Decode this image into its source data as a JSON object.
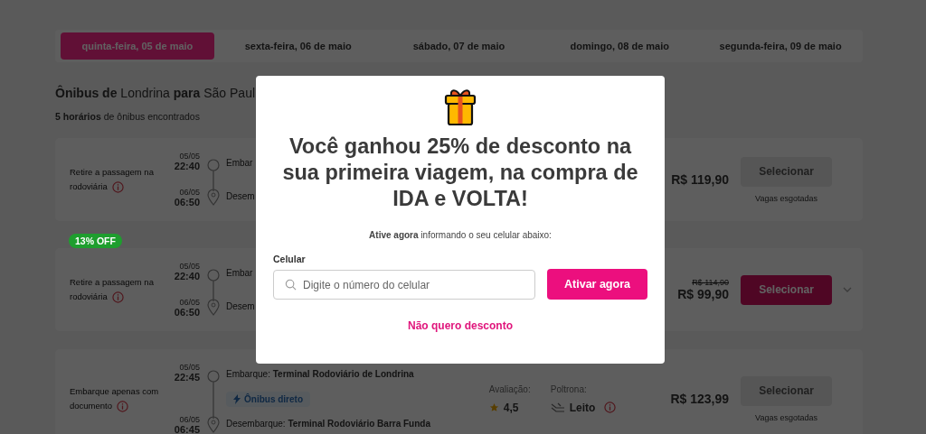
{
  "dates": [
    {
      "label": "quinta-feira, 05 de maio",
      "selected": true
    },
    {
      "label": "sexta-feira, 06 de maio",
      "selected": false
    },
    {
      "label": "sábado, 07 de maio",
      "selected": false
    },
    {
      "label": "domingo, 08 de maio",
      "selected": false
    },
    {
      "label": "segunda-feira, 09 de maio",
      "selected": false
    }
  ],
  "heading": "**Ônibus de** Londrina **para** São Paul",
  "result_count": "**5 horários** de ônibus encontrados",
  "trips": [
    {
      "note": "Retire a passagem na rodoviária",
      "depart_date": "05/05",
      "depart_time": "22:40",
      "arrive_date": "06/05",
      "arrive_time": "06:50",
      "board_label": "Embar",
      "alight_label": "Desem",
      "price": "R$ 119,90",
      "button": {
        "label": "Selecionar",
        "disabled": true
      },
      "status": "Vagas esgotadas",
      "expand_toggle": false
    },
    {
      "badge": "13% OFF",
      "note": "Retire a passagem na rodoviária",
      "depart_date": "05/05",
      "depart_time": "22:40",
      "arrive_date": "06/05",
      "arrive_time": "06:50",
      "board_label": "Embar",
      "alight_label": "Desem",
      "price_old": "R$ 114,90",
      "price": "R$ 99,90",
      "button": {
        "label": "Selecionar",
        "disabled": false
      },
      "expand_toggle": true
    },
    {
      "note": "Embarque apenas com documento",
      "depart_date": "05/05",
      "depart_time": "22:45",
      "arrive_date": "06/05",
      "arrive_time": "06:45",
      "board_label": "Embarque:",
      "board_place": "Terminal Rodoviário de Londrina",
      "direct_tag": "Ônibus direto",
      "alight_label": "Desembarque:",
      "alight_place": "Terminal Rodoviário Barra Funda",
      "rating_label": "Avaliação:",
      "rating": "4,5",
      "seat_label": "Poltrona:",
      "seat": "Leito",
      "price": "R$ 123,99",
      "button": {
        "label": "Selecionar",
        "disabled": true
      },
      "status": "Vagas esgotadas",
      "expand_toggle": false
    }
  ],
  "modal": {
    "title": "Você ganhou 25% de desconto na sua primeira viagem, na compra de IDA e VOLTA!",
    "subtitle": "**Ative agora** informando o seu celular abaixo:",
    "field_label": "Celular",
    "placeholder": "Digite o número do celular",
    "submit": "Ativar agora",
    "decline": "Não quero desconto"
  }
}
